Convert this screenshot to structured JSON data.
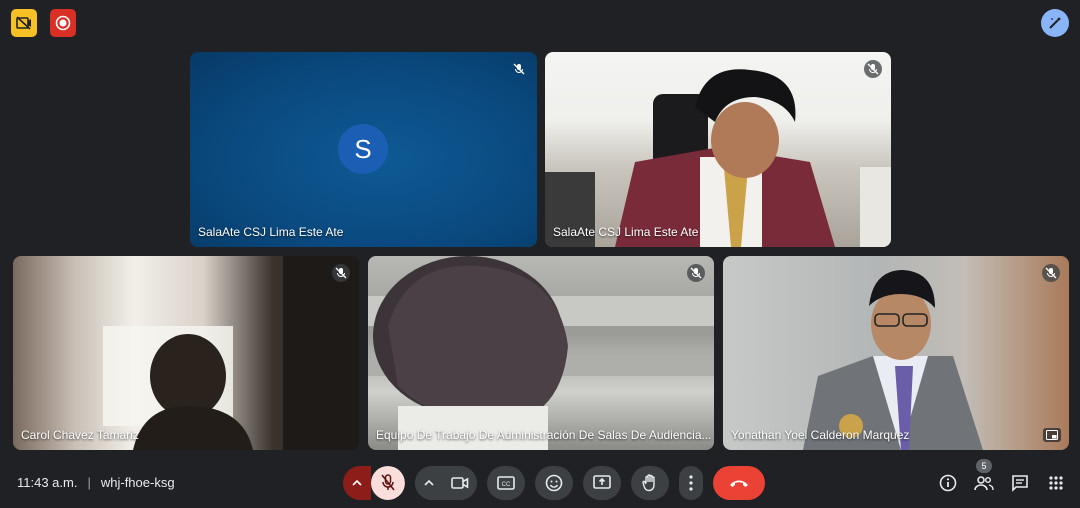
{
  "meeting": {
    "time": "11:43 a.m.",
    "separator": "|",
    "code": "whj-fhoe-ksg"
  },
  "participants": [
    {
      "name": "SalaAte CSJ Lima Este Ate",
      "avatar_letter": "S",
      "muted": true
    },
    {
      "name": "SalaAte CSJ Lima Este Ate",
      "muted": true
    },
    {
      "name": "Carol Chavez Tamariz",
      "muted": true
    },
    {
      "name": "Equipo De Trabajo De Administración De Salas De Audiencia...",
      "muted": true
    },
    {
      "name": "Yonathan Yoel Calderon Marquez",
      "muted": true
    }
  ],
  "people_count": "5",
  "colors": {
    "background": "#202124",
    "hangup": "#ea4335",
    "mic_off": "#f9dedc",
    "accent": "#8ab4f8"
  },
  "icons": {
    "top_left": [
      "no-video-badge-icon",
      "recording-icon"
    ],
    "top_right": "edit-effects-icon",
    "controls": [
      "chevron-up-icon",
      "mic-off-icon",
      "chevron-up-icon",
      "camera-icon",
      "captions-icon",
      "emoji-icon",
      "present-screen-icon",
      "raise-hand-icon",
      "more-vert-icon",
      "hangup-icon"
    ],
    "right": [
      "info-icon",
      "people-icon",
      "chat-icon",
      "activities-icon"
    ]
  }
}
